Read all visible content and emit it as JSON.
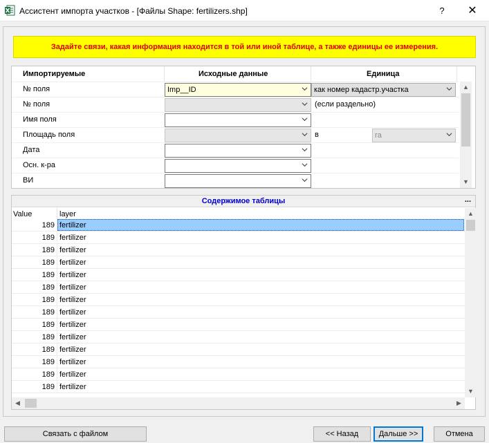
{
  "window": {
    "title": "Ассистент импорта участков - [Файлы Shape: fertilizers.shp]",
    "help": "?",
    "close": "✕"
  },
  "banner": "Задайте связи, какая информация находится в той или иной таблице, а также единицы ее измерения.",
  "mapping": {
    "headers": {
      "imported": "Импортируемые",
      "source": "Исходные данные",
      "unit": "Единица"
    },
    "rows": [
      {
        "label": "№ поля",
        "source": "Imp__ID",
        "source_state": "active",
        "unit": "как номер кадастр.участка",
        "unit_kind": "combo"
      },
      {
        "label": "№ поля",
        "source": "",
        "source_state": "disabled",
        "unit": "(если раздельно)",
        "unit_kind": "text"
      },
      {
        "label": "Имя поля",
        "source": "",
        "source_state": "enabled",
        "unit": "",
        "unit_kind": "none"
      },
      {
        "label": "Площадь поля",
        "source": "",
        "source_state": "disabled",
        "unit": "в",
        "unit_kind": "text-with-combo",
        "unit_combo": "га"
      },
      {
        "label": "Дата",
        "source": "",
        "source_state": "enabled",
        "unit": "",
        "unit_kind": "none"
      },
      {
        "label": "Осн. к-ра",
        "source": "",
        "source_state": "enabled",
        "unit": "",
        "unit_kind": "none"
      },
      {
        "label": "ВИ",
        "source": "",
        "source_state": "enabled",
        "unit": "",
        "unit_kind": "none"
      }
    ]
  },
  "table": {
    "title": "Содержимое таблицы",
    "menu": "...",
    "columns": [
      "Value",
      "layer"
    ],
    "rows": [
      {
        "value": "189",
        "layer": "fertilizer",
        "selected": true
      },
      {
        "value": "189",
        "layer": "fertilizer"
      },
      {
        "value": "189",
        "layer": "fertilizer"
      },
      {
        "value": "189",
        "layer": "fertilizer"
      },
      {
        "value": "189",
        "layer": "fertilizer"
      },
      {
        "value": "189",
        "layer": "fertilizer"
      },
      {
        "value": "189",
        "layer": "fertilizer"
      },
      {
        "value": "189",
        "layer": "fertilizer"
      },
      {
        "value": "189",
        "layer": "fertilizer"
      },
      {
        "value": "189",
        "layer": "fertilizer"
      },
      {
        "value": "189",
        "layer": "fertilizer"
      },
      {
        "value": "189",
        "layer": "fertilizer"
      },
      {
        "value": "189",
        "layer": "fertilizer"
      },
      {
        "value": "189",
        "layer": "fertilizer"
      }
    ]
  },
  "buttons": {
    "link_file": "Связать с файлом",
    "back": "<< Назад",
    "next": "Дальше >>",
    "cancel": "Отмена"
  },
  "icons": {
    "app": "excel-import-icon",
    "dropdown": "chevron-down-icon"
  }
}
